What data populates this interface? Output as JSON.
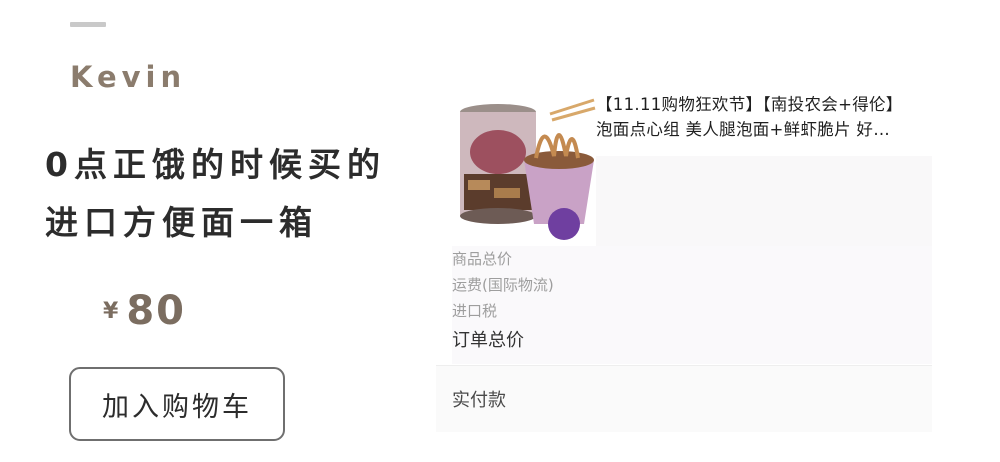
{
  "author": "Kevin",
  "headline": {
    "line1": "0点正饿的时候买的",
    "line2": "进口方便面一箱"
  },
  "price": {
    "currency": "¥",
    "amount": "80"
  },
  "add_to_cart_label": "加入购物车",
  "order": {
    "product_title_line1": "【11.11购物狂欢节】【南投农会+得伦】",
    "product_title_line2": "泡面点心组 美人腿泡面+鲜虾脆片 好…",
    "fee_labels": [
      "商品总价",
      "运费(国际物流)",
      "进口税"
    ],
    "order_total_label": "订单总价",
    "actual_payment_label": "实付款"
  },
  "colors": {
    "accent_brown": "#7b6d60",
    "badge_purple": "#6f3fa0"
  }
}
